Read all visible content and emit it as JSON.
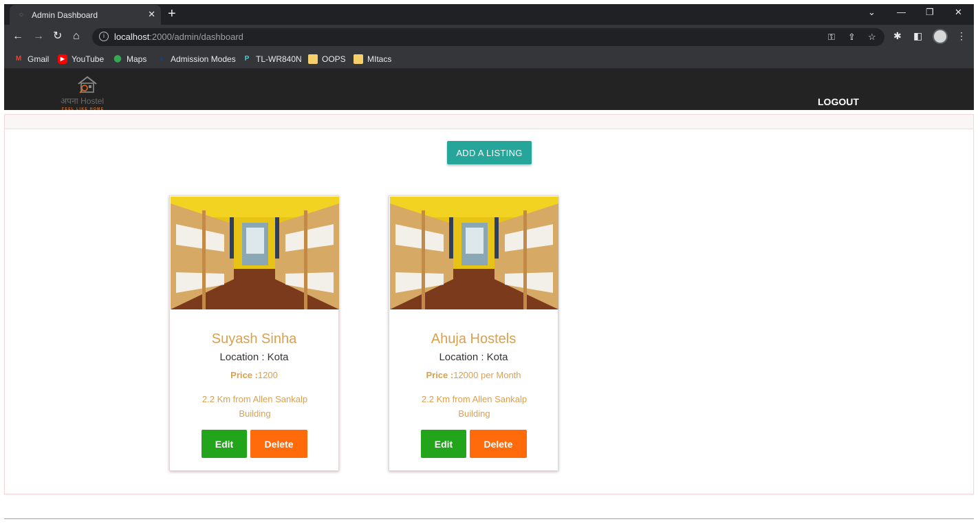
{
  "browser": {
    "tab_title": "Admin Dashboard",
    "url_host": "localhost",
    "url_path": ":2000/admin/dashboard",
    "bookmarks": [
      {
        "label": "Gmail",
        "icon": "gmail-icon"
      },
      {
        "label": "YouTube",
        "icon": "youtube-icon"
      },
      {
        "label": "Maps",
        "icon": "maps-icon"
      },
      {
        "label": "Admission Modes",
        "icon": "cap-icon"
      },
      {
        "label": "TL-WR840N",
        "icon": "router-icon"
      },
      {
        "label": "OOPS",
        "icon": "folder-icon"
      },
      {
        "label": "MItacs",
        "icon": "folder-icon"
      }
    ]
  },
  "header": {
    "brand": "अपना Hostel",
    "tagline": "FEEL LIKE HOME",
    "logout_label": "LOGOUT"
  },
  "main": {
    "add_listing_label": "ADD A LISTING",
    "listings": [
      {
        "name": "Suyash Sinha",
        "location": "Location : Kota",
        "price_label": "Price :",
        "price_value": "1200",
        "distance": "2.2 Km from Allen Sankalp Building",
        "edit_label": "Edit",
        "delete_label": "Delete"
      },
      {
        "name": "Ahuja Hostels",
        "location": "Location : Kota",
        "price_label": "Price :",
        "price_value": "12000 per Month",
        "distance": "2.2 Km from Allen Sankalp Building",
        "edit_label": "Edit",
        "delete_label": "Delete"
      }
    ]
  },
  "colors": {
    "accent_teal": "#26a69a",
    "edit_green": "#22a51b",
    "delete_orange": "#ff6a0a",
    "card_text_gold": "#d9a04f",
    "header_dark": "#232323"
  }
}
